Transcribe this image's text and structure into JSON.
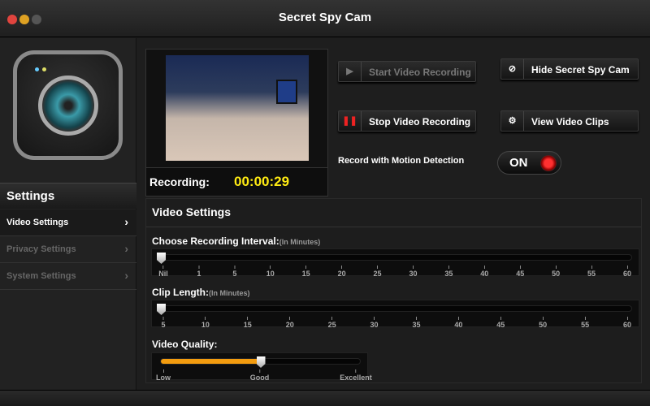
{
  "window": {
    "title": "Secret Spy Cam"
  },
  "sidebar": {
    "header": "Settings",
    "items": [
      {
        "label": "Video Settings",
        "active": true
      },
      {
        "label": "Privacy Settings",
        "active": false
      },
      {
        "label": "System Settings",
        "active": false
      }
    ]
  },
  "preview": {
    "recording_label": "Recording:",
    "recording_time": "00:00:29"
  },
  "buttons": {
    "start": "Start Video Recording",
    "stop": "Stop Video Recording",
    "hide": "Hide Secret Spy Cam",
    "view": "View Video Clips"
  },
  "motion": {
    "label": "Record with Motion Detection",
    "state": "ON"
  },
  "video_settings": {
    "title": "Video Settings",
    "interval": {
      "label": "Choose Recording Interval:",
      "unit": "(In Minutes)",
      "ticks": [
        "Nil",
        "1",
        "5",
        "10",
        "15",
        "20",
        "25",
        "30",
        "35",
        "40",
        "45",
        "50",
        "55",
        "60"
      ],
      "value_index": 0
    },
    "clip": {
      "label": "Clip Length:",
      "unit": "(In Minutes)",
      "ticks": [
        "5",
        "10",
        "15",
        "20",
        "25",
        "30",
        "35",
        "40",
        "45",
        "50",
        "55",
        "60"
      ],
      "value_index": 0
    },
    "quality": {
      "label": "Video Quality:",
      "ticks": [
        "Low",
        "Good",
        "Excellent"
      ],
      "value_index": 1
    }
  },
  "colors": {
    "accent": "#f39c0f",
    "timer": "#ffeb12",
    "record": "#ff2020"
  }
}
